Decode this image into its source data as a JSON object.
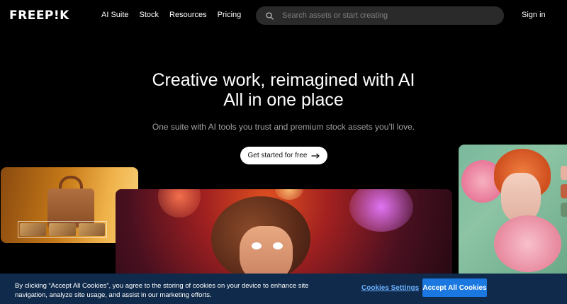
{
  "header": {
    "logo": "FREEP!K",
    "nav": [
      "AI Suite",
      "Stock",
      "Resources",
      "Pricing"
    ],
    "search_placeholder": "Search assets or start creating",
    "signin": "Sign in"
  },
  "hero": {
    "title_line1": "Creative work, reimagined with AI",
    "title_line2": "All in one place",
    "subtitle": "One suite with AI tools you trust and premium stock assets you’ll love.",
    "cta": "Get started for free"
  },
  "cookie": {
    "text": "By clicking “Accept All Cookies”, you agree to the storing of cookies on your device to enhance site navigation, analyze site usage, and assist in our marketing efforts.",
    "settings": "Cookies Settings",
    "accept": "Accept All Cookies"
  },
  "colors": {
    "background": "#000000",
    "search_bg": "#2a2a2a",
    "cookie_bg": "#0f2a4a",
    "accept_button": "#1a78e0",
    "settings_link": "#6ab0ff"
  },
  "icons": [
    "search-icon",
    "arrow-right-icon"
  ]
}
